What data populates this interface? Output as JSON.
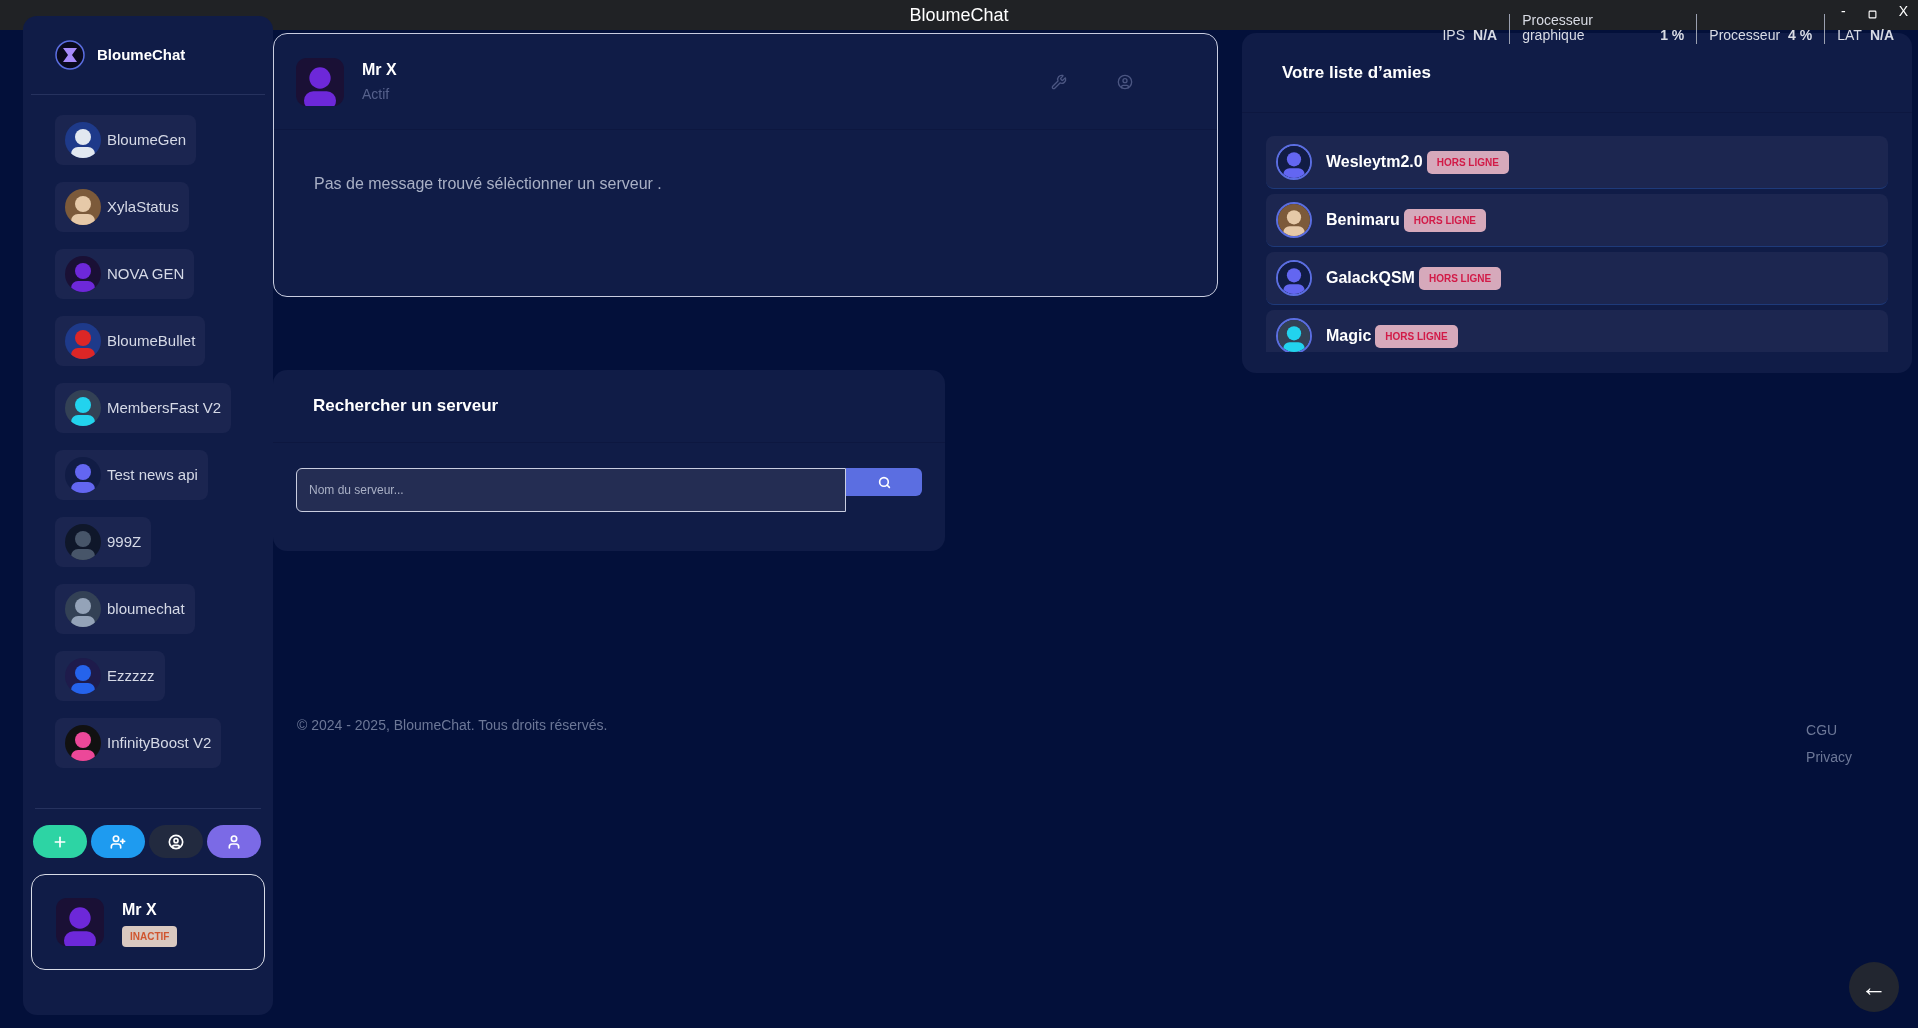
{
  "window": {
    "title": "BloumeChat",
    "controls": [
      {
        "kind": "minimize",
        "label": "-"
      },
      {
        "kind": "maximize"
      },
      {
        "kind": "close",
        "label": "X"
      }
    ]
  },
  "stats": [
    {
      "label": "IPS",
      "value": "N/A"
    },
    {
      "label": "Processeur graphique",
      "value": "1 %"
    },
    {
      "label": "Processeur",
      "value": "4 %"
    },
    {
      "label": "LAT",
      "value": "N/A"
    }
  ],
  "sidebar": {
    "brand": "BloumeChat",
    "servers": [
      "BloumeGen",
      "XylaStatus",
      "NOVA GEN",
      "BloumeBullet",
      "MembersFast V2",
      "Test news api",
      "999Z",
      "bloumechat",
      "Ezzzzz",
      "InfinityBoost V2"
    ],
    "actions": [
      {
        "kind": "create"
      },
      {
        "kind": "add-friend"
      },
      {
        "kind": "profile"
      },
      {
        "kind": "account"
      }
    ],
    "profile": {
      "name": "Mr X",
      "status": "INACTIF"
    }
  },
  "chat": {
    "user": {
      "name": "Mr X",
      "status": "Actif"
    },
    "tools": [
      {
        "kind": "settings"
      },
      {
        "kind": "profile"
      }
    ],
    "empty_message": "Pas de message trouvé sélèctionner un serveur ."
  },
  "search": {
    "title": "Rechercher un serveur",
    "placeholder": "Nom du serveur..."
  },
  "friends": {
    "title": "Votre liste d’amies",
    "items": [
      {
        "name": "Wesleytm2.0",
        "status": "HORS LIGNE"
      },
      {
        "name": "Benimaru",
        "status": "HORS LIGNE"
      },
      {
        "name": "GalackQSM",
        "status": "HORS LIGNE"
      },
      {
        "name": "Magic",
        "status": "HORS LIGNE"
      }
    ]
  },
  "footer": {
    "copyright": "© 2024 - 2025, BloumeChat. Tous droits réservés.",
    "links": [
      "CGU",
      "Privacy"
    ]
  },
  "back_button": {
    "label": "←"
  }
}
